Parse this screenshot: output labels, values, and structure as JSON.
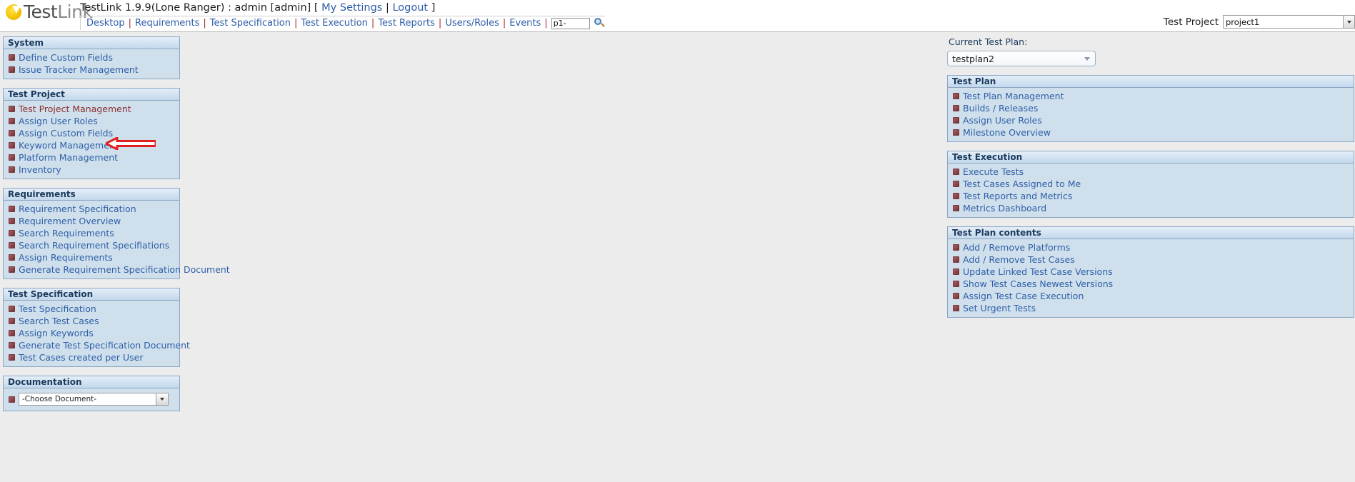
{
  "app": {
    "logo_primary": "Test",
    "logo_secondary": "Link",
    "header_title": "TestLink 1.9.9(Lone Ranger) : admin [admin] [",
    "my_settings": "My Settings",
    "pipe": "|",
    "logout": "Logout",
    "bracket_close": "]"
  },
  "nav": {
    "items": [
      {
        "label": "Desktop"
      },
      {
        "label": "Requirements"
      },
      {
        "label": "Test Specification"
      },
      {
        "label": "Test Execution"
      },
      {
        "label": "Test Reports"
      },
      {
        "label": "Users/Roles"
      },
      {
        "label": "Events"
      }
    ],
    "separator": "|",
    "search_value": "p1-",
    "search_icon": "magnifier-icon"
  },
  "test_project_selector": {
    "label": "Test Project",
    "value": "project1"
  },
  "current_test_plan": {
    "label": "Current Test Plan:",
    "value": "testplan2"
  },
  "left_panels": [
    {
      "title": "System",
      "items": [
        {
          "label": "Define Custom Fields",
          "highlight": false
        },
        {
          "label": "Issue Tracker Management",
          "highlight": false
        }
      ]
    },
    {
      "title": "Test Project",
      "items": [
        {
          "label": "Test Project Management",
          "highlight": true
        },
        {
          "label": "Assign User Roles",
          "highlight": false
        },
        {
          "label": "Assign Custom Fields",
          "highlight": false
        },
        {
          "label": "Keyword Management",
          "highlight": false
        },
        {
          "label": "Platform Management",
          "highlight": false
        },
        {
          "label": "Inventory",
          "highlight": false
        }
      ]
    },
    {
      "title": "Requirements",
      "items": [
        {
          "label": "Requirement Specification",
          "highlight": false
        },
        {
          "label": "Requirement Overview",
          "highlight": false
        },
        {
          "label": "Search Requirements",
          "highlight": false
        },
        {
          "label": "Search Requirement Specifiations",
          "highlight": false
        },
        {
          "label": "Assign Requirements",
          "highlight": false
        },
        {
          "label": "Generate Requirement Specification Document",
          "highlight": false
        }
      ]
    },
    {
      "title": "Test Specification",
      "items": [
        {
          "label": "Test Specification",
          "highlight": false
        },
        {
          "label": "Search Test Cases",
          "highlight": false
        },
        {
          "label": "Assign Keywords",
          "highlight": false
        },
        {
          "label": "Generate Test Specification Document",
          "highlight": false
        },
        {
          "label": "Test Cases created per User",
          "highlight": false
        }
      ]
    }
  ],
  "documentation_panel": {
    "title": "Documentation",
    "select_value": "-Choose Document-"
  },
  "right_panels": [
    {
      "title": "Test Plan",
      "items": [
        {
          "label": "Test Plan Management"
        },
        {
          "label": "Builds / Releases"
        },
        {
          "label": "Assign User Roles"
        },
        {
          "label": "Milestone Overview"
        }
      ]
    },
    {
      "title": "Test Execution",
      "items": [
        {
          "label": "Execute Tests"
        },
        {
          "label": "Test Cases Assigned to Me"
        },
        {
          "label": "Test Reports and Metrics"
        },
        {
          "label": "Metrics Dashboard"
        }
      ]
    },
    {
      "title": "Test Plan contents",
      "items": [
        {
          "label": "Add / Remove Platforms"
        },
        {
          "label": "Add / Remove Test Cases"
        },
        {
          "label": "Update Linked Test Case Versions"
        },
        {
          "label": "Show Test Cases Newest Versions"
        },
        {
          "label": "Assign Test Case Execution"
        },
        {
          "label": "Set Urgent Tests"
        }
      ]
    }
  ],
  "annotation": {
    "arrow_color": "#e02020",
    "points_to": "Test Project Management"
  }
}
